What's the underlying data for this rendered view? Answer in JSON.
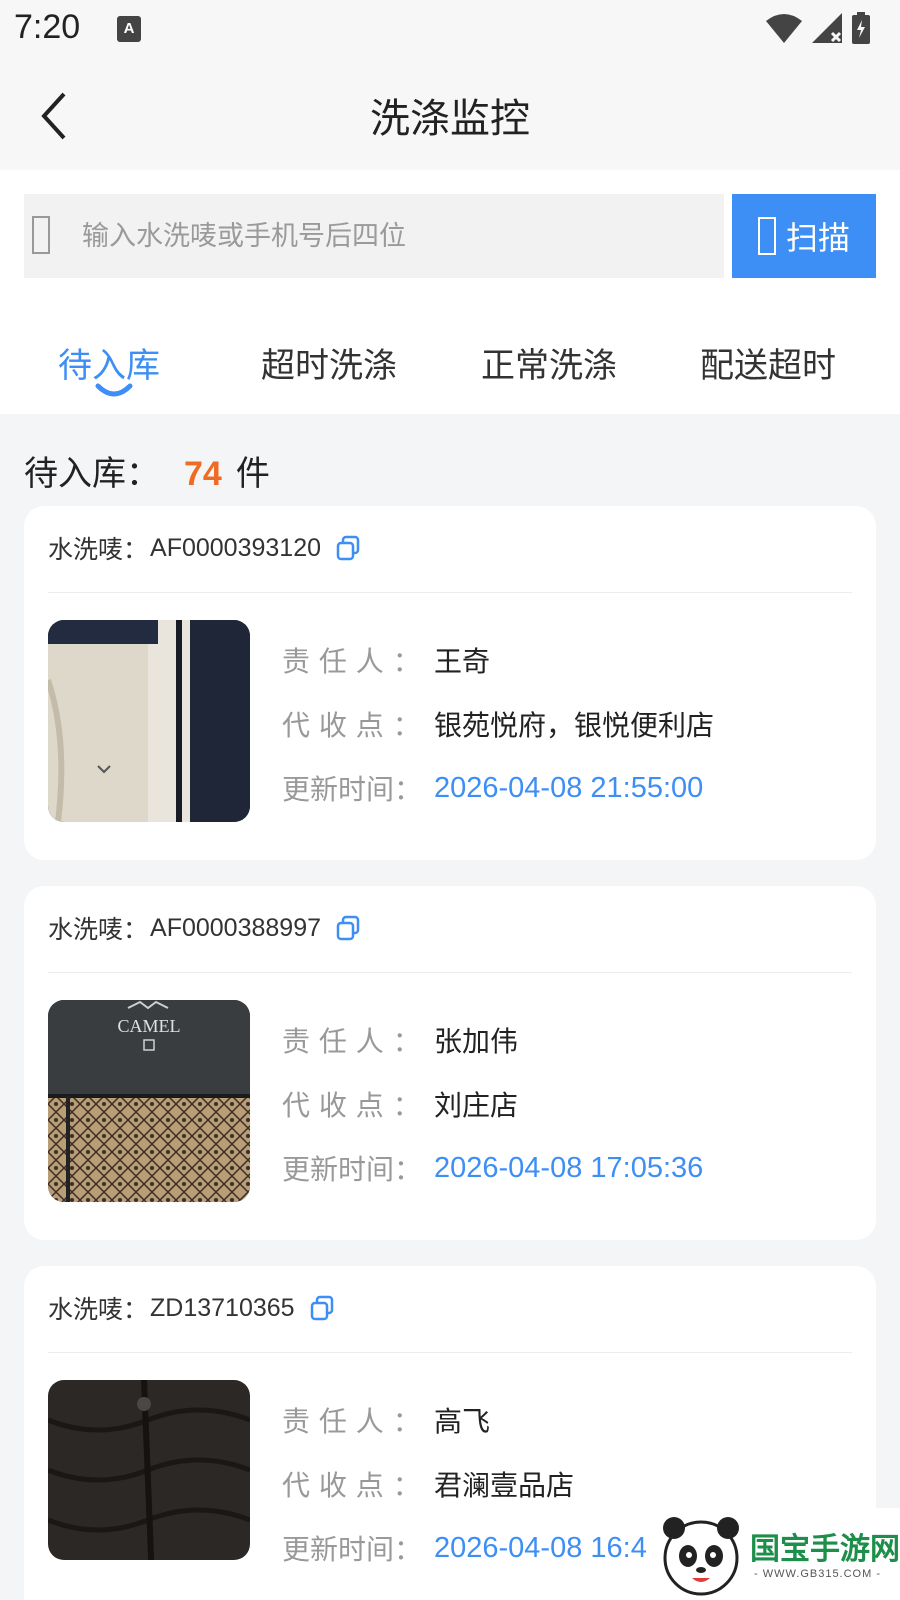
{
  "status_bar": {
    "time": "7:20",
    "indicator": "A"
  },
  "nav": {
    "title": "洗涤监控"
  },
  "search": {
    "placeholder": "输入水洗唛或手机号后四位",
    "button_label": "扫描"
  },
  "tabs": [
    {
      "label": "待入库",
      "active": true
    },
    {
      "label": "超时洗涤",
      "active": false
    },
    {
      "label": "正常洗涤",
      "active": false
    },
    {
      "label": "配送超时",
      "active": false
    }
  ],
  "summary": {
    "label": "待入库：",
    "count": "74",
    "unit": "件"
  },
  "card_labels": {
    "code": "水洗唛：",
    "person": "责 任 人 ：",
    "point": "代 收 点 ：",
    "time": "更新时间："
  },
  "items": [
    {
      "code": "AF0000393120",
      "person": "王奇",
      "point": "银苑悦府，银悦便利店",
      "time": "2026-04-08 21:55:00"
    },
    {
      "code": "AF0000388997",
      "person": "张加伟",
      "point": "刘庄店",
      "time": "2026-04-08 17:05:36",
      "brand": "CAMEL"
    },
    {
      "code": "ZD13710365",
      "person": "高飞",
      "point": "君澜壹品店",
      "time": "2026-04-08 16:47"
    }
  ],
  "watermark": {
    "name": "国宝手游网",
    "url": "- WWW.GB315.COM -"
  },
  "colors": {
    "accent": "#3d8ef5",
    "count": "#ef6a22",
    "label": "#999999"
  }
}
